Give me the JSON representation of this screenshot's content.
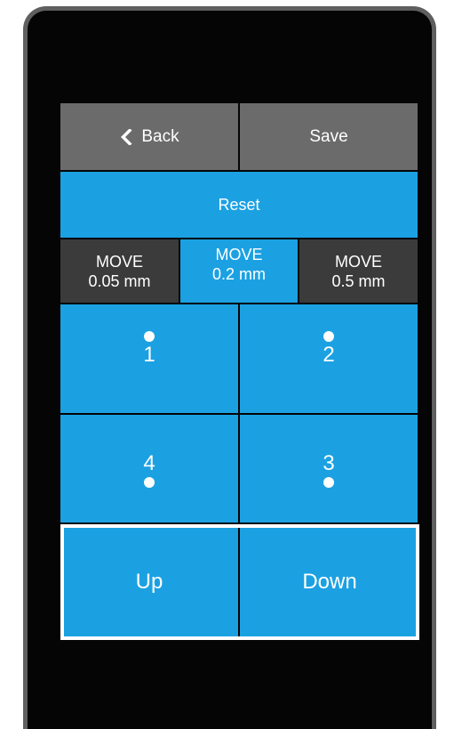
{
  "header": {
    "back_label": "Back",
    "save_label": "Save"
  },
  "reset_label": "Reset",
  "move_options": [
    {
      "line1": "MOVE",
      "line2": "0.05 mm",
      "selected": false
    },
    {
      "line1": "MOVE",
      "line2": "0.2 mm",
      "selected": true
    },
    {
      "line1": "MOVE",
      "line2": "0.5 mm",
      "selected": false
    }
  ],
  "points": [
    {
      "label": "1"
    },
    {
      "label": "2"
    },
    {
      "label": "4"
    },
    {
      "label": "3"
    }
  ],
  "z_controls": {
    "up_label": "Up",
    "down_label": "Down"
  },
  "colors": {
    "accent": "#1ba1e2",
    "header_gray": "#6b6b6b",
    "unselected_dark": "#3b3b3b",
    "bezel": "#050505",
    "highlight_border": "#ffffff"
  },
  "icons": {
    "back": "chevron-left-icon",
    "point_marker": "dot-icon"
  }
}
